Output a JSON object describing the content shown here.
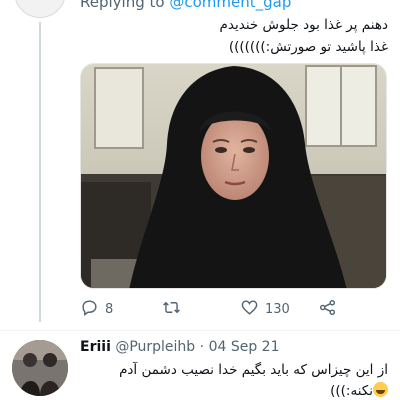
{
  "tweet": {
    "replying_prefix": "Replying to ",
    "replying_handle": "@comment_gap",
    "text_lines": [
      "دهنم پر غذا بود جلوش خندیدم",
      "غذا پاشید تو صورتش:)))))))"
    ],
    "actions": {
      "reply_count": "8",
      "retweet_count": "",
      "like_count": "130"
    },
    "icons": [
      "reply-icon",
      "retweet-icon",
      "like-icon",
      "share-icon"
    ]
  },
  "reply": {
    "display_name": "Eriii",
    "handle": "@Purpleihb",
    "separator": "·",
    "date": "04 Sep 21",
    "text_lines": [
      "از این چیزاس که باید بگیم خدا نصیب دشمن آدم",
      "نکنه:)))"
    ]
  },
  "colors": {
    "link": "#1d9bf0",
    "secondary_text": "#536471",
    "primary_text": "#0f1419",
    "thread_line": "#cfd9de"
  }
}
